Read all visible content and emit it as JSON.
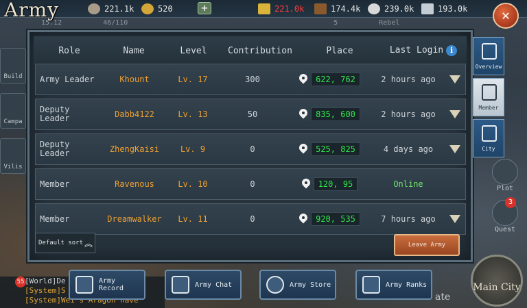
{
  "header": {
    "title": "Army",
    "resources": [
      {
        "icon": "silver-coin-icon",
        "value": "221.1k"
      },
      {
        "icon": "gold-icon",
        "value": "520"
      },
      {
        "icon": "food-icon",
        "value": "221.0k",
        "color": "#ff3b3b"
      },
      {
        "icon": "wood-icon",
        "value": "174.4k"
      },
      {
        "icon": "stone-icon",
        "value": "239.0k"
      },
      {
        "icon": "iron-icon",
        "value": "193.0k"
      }
    ],
    "plus_label": "+",
    "close_label": "✕",
    "sub_left": "15.12",
    "sub_mid": "46/110",
    "sub_right": "5",
    "sub_rebel": "Rebel"
  },
  "table": {
    "columns": {
      "role": "Role",
      "name": "Name",
      "level": "Level",
      "contribution": "Contribution",
      "place": "Place",
      "last_login": "Last Login"
    },
    "rows": [
      {
        "role": "Army Leader",
        "name": "Khount",
        "level": "Lv. 17",
        "contribution": "300",
        "place": "622, 762",
        "last_login": "2 hours ago"
      },
      {
        "role": "Deputy Leader",
        "name": "Dabb4122",
        "level": "Lv. 13",
        "contribution": "50",
        "place": "835, 600",
        "last_login": "2 hours ago"
      },
      {
        "role": "Deputy Leader",
        "name": "ZhengKaisi",
        "level": "Lv. 9",
        "contribution": "0",
        "place": "525, 825",
        "last_login": "4 days ago"
      },
      {
        "role": "Member",
        "name": "Ravenous",
        "level": "Lv. 10",
        "contribution": "0",
        "place": "120, 95",
        "last_login": "Online"
      },
      {
        "role": "Member",
        "name": "Dreamwalker",
        "level": "Lv. 11",
        "contribution": "0",
        "place": "920, 535",
        "last_login": "7 hours ago"
      }
    ]
  },
  "controls": {
    "default_sort": "Default sort",
    "leave_army": "Leave Army"
  },
  "right_tabs": {
    "overview": "Overview",
    "member": "Member",
    "city": "City"
  },
  "right_side": {
    "plot": "Plot",
    "quest": "Quest",
    "quest_badge": "3"
  },
  "left_nav": {
    "build": "Build",
    "campaign": "Campa",
    "vilis": "Vilis"
  },
  "bottom": {
    "army_record": "Army Record",
    "army_chat": "Army Chat",
    "army_store": "Army Store",
    "army_ranks": "Army Ranks",
    "main_city": "Main City",
    "chat_badge": "55",
    "chat_line1": "[World]De",
    "chat_line2": "[System]S",
    "chat_line3": "[System]Wei's Aragon have",
    "overlay": "ate"
  }
}
